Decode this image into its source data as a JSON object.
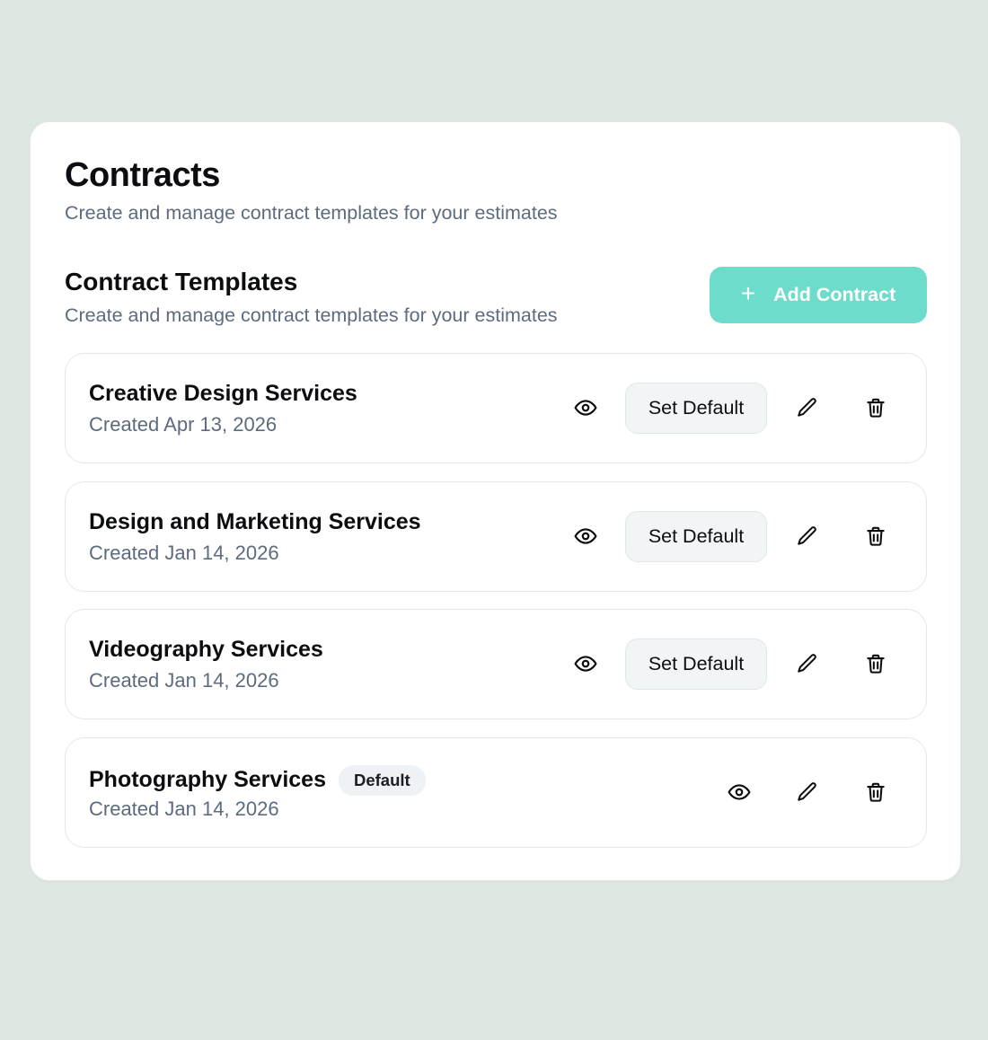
{
  "header": {
    "title": "Contracts",
    "subtitle": "Create and manage contract templates for your estimates"
  },
  "section": {
    "title": "Contract Templates",
    "subtitle": "Create and manage contract templates for your estimates",
    "add_button_label": "Add Contract",
    "add_button_icon": "plus-icon",
    "accent_color": "#6ddccb"
  },
  "contracts": [
    {
      "name": "Creative Design Services",
      "created": "Created Apr 13, 2026",
      "is_default": false,
      "badge": "",
      "set_default_label": "Set Default"
    },
    {
      "name": "Design and Marketing Services",
      "created": "Created Jan 14, 2026",
      "is_default": false,
      "badge": "",
      "set_default_label": "Set Default"
    },
    {
      "name": "Videography Services",
      "created": "Created Jan 14, 2026",
      "is_default": false,
      "badge": "",
      "set_default_label": "Set Default"
    },
    {
      "name": "Photography Services",
      "created": "Created Jan 14, 2026",
      "is_default": true,
      "badge": "Default",
      "set_default_label": ""
    }
  ],
  "row_icons": [
    "eye-icon",
    "pencil-icon",
    "trash-icon"
  ]
}
